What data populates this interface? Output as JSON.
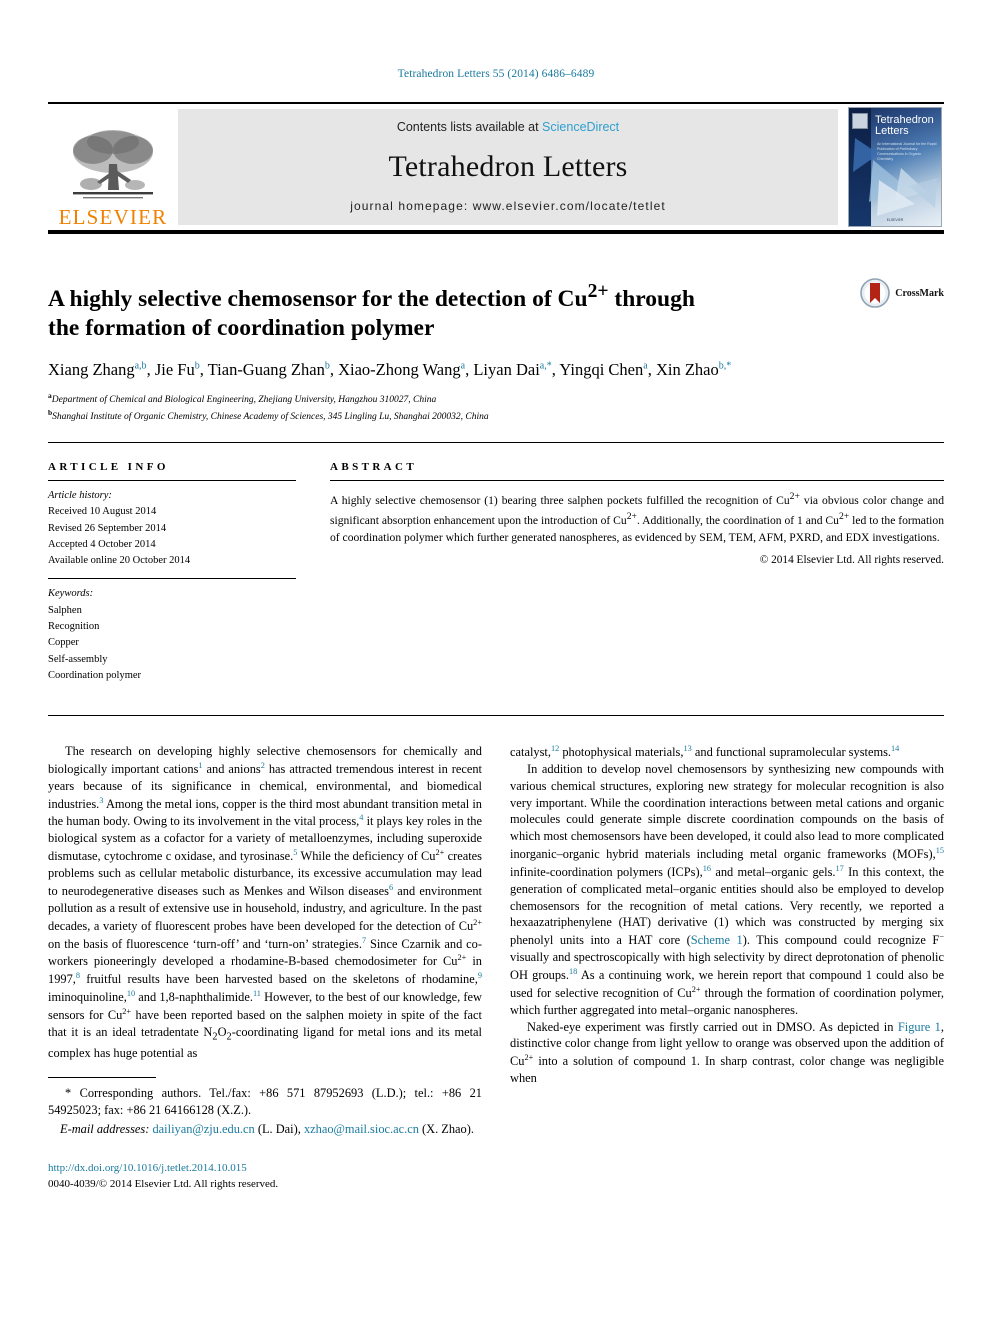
{
  "running_head": "Tetrahedron Letters 55 (2014) 6486–6489",
  "masthead": {
    "publisher_word": "ELSEVIER",
    "contents_prefix": "Contents lists available at ",
    "contents_link": "ScienceDirect",
    "journal_name": "Tetrahedron Letters",
    "homepage": "journal homepage: www.elsevier.com/locate/tetlet",
    "cover_title_line1": "Tetrahedron",
    "cover_title_line2": "Letters",
    "cover_subtitle": "An International Journal for the Rapid Publication of Preliminary Communications in Organic Chemistry",
    "cover_footer": "ELSEVIER"
  },
  "crossmark": {
    "label": "CrossMark"
  },
  "title": "A highly selective chemosensor for the detection of Cu2+ through the formation of coordination polymer",
  "title_parts": {
    "line1_a": "A highly selective chemosensor for the detection of Cu",
    "line1_sup": "2+",
    "line1_b": " through",
    "line2": "the formation of coordination polymer"
  },
  "authors": [
    {
      "name": "Xiang Zhang",
      "marks": "a,b",
      "sep": ", "
    },
    {
      "name": "Jie Fu",
      "marks": "b",
      "sep": ", "
    },
    {
      "name": "Tian-Guang Zhan",
      "marks": "b",
      "sep": ", "
    },
    {
      "name": "Xiao-Zhong Wang",
      "marks": "a",
      "sep": ", "
    },
    {
      "name": "Liyan Dai",
      "marks": "a,*",
      "sep": ", "
    },
    {
      "name": "Yingqi Chen",
      "marks": "a",
      "sep": ", "
    },
    {
      "name": "Xin Zhao",
      "marks": "b,*",
      "sep": ""
    }
  ],
  "affiliations": [
    {
      "mark": "a",
      "text": "Department of Chemical and Biological Engineering, Zhejiang University, Hangzhou 310027, China"
    },
    {
      "mark": "b",
      "text": "Shanghai Institute of Organic Chemistry, Chinese Academy of Sciences, 345 Lingling Lu, Shanghai 200032, China"
    }
  ],
  "article_info": {
    "heading": "ARTICLE INFO",
    "history_label": "Article history:",
    "history": [
      "Received 10 August 2014",
      "Revised 26 September 2014",
      "Accepted 4 October 2014",
      "Available online 20 October 2014"
    ],
    "keywords_label": "Keywords:",
    "keywords": [
      "Salphen",
      "Recognition",
      "Copper",
      "Self-assembly",
      "Coordination polymer"
    ]
  },
  "abstract": {
    "heading": "ABSTRACT",
    "p1_a": "A highly selective chemosensor (1) bearing three salphen pockets fulfilled the recognition of Cu",
    "p1_sup1": "2+",
    "p1_b": " via obvious color change and significant absorption enhancement upon the introduction of Cu",
    "p1_sup2": "2+",
    "p1_c": ". Additionally, the coordination of 1 and Cu",
    "p1_sup3": "2+",
    "p1_d": " led to the formation of coordination polymer which further generated nanospheres, as evidenced by SEM, TEM, AFM, PXRD, and EDX investigations.",
    "copyright": "© 2014 Elsevier Ltd. All rights reserved."
  },
  "body": {
    "left": {
      "p1_s1": "The research on developing highly selective chemosensors for chemically and biologically important cations",
      "r1": "1",
      "p1_s2": " and anions",
      "r2": "2",
      "p1_s3": " has attracted tremendous interest in recent years because of its significance in chemical, environmental, and biomedical industries.",
      "r3": "3",
      "p1_s4": " Among the metal ions, copper is the third most abundant transition metal in the human body. Owing to its involvement in the vital process,",
      "r4": "4",
      "p1_s5": " it plays key roles in the biological system as a cofactor for a variety of metalloenzymes, including superoxide dismutase, cytochrome c oxidase, and tyrosinase.",
      "r5": "5",
      "p1_s6": " While the deficiency of Cu",
      "sup_cu1": "2+",
      "p1_s7": " creates problems such as cellular metabolic disturbance, its excessive accumulation may lead to neurodegenerative diseases such as Menkes and Wilson diseases",
      "r6": "6",
      "p1_s8": " and environment pollution as a result of extensive use in household, industry, and agriculture. In the past decades, a variety of fluorescent probes have been developed for the detection of Cu",
      "sup_cu2": "2+",
      "p1_s9": " on the basis of fluorescence ‘turn-off’ and ‘turn-on’ strategies.",
      "r7": "7",
      "p1_s10": " Since Czarnik and co-workers pioneeringly developed a rhodamine-B-based chemodosimeter for Cu",
      "sup_cu3": "2+",
      "p1_s11": " in 1997,",
      "r8": "8",
      "p1_s12": " fruitful results have been harvested based on the skeletons of rhodamine,",
      "r9": "9",
      "p1_s13": " iminoquinoline,",
      "r10": "10",
      "p1_s14": " and 1,8-naphthalimide.",
      "r11": "11",
      "p1_s15": " However, to the best of our knowledge, few sensors for Cu",
      "sup_cu4": "2+",
      "p1_s16": " have been reported based on the salphen moiety in spite of the fact that it is an ideal tetradentate N",
      "sub_n": "2",
      "p1_s17": "O",
      "sub_o": "2",
      "p1_s18": "-coordinating ligand for metal ions and its metal complex has huge potential as"
    },
    "right": {
      "p1_s1": "catalyst,",
      "r12": "12",
      "p1_s2": " photophysical materials,",
      "r13": "13",
      "p1_s3": " and functional supramolecular systems.",
      "r14": "14",
      "p2_s1": "In addition to develop novel chemosensors by synthesizing new compounds with various chemical structures, exploring new strategy for molecular recognition is also very important. While the coordination interactions between metal cations and organic molecules could generate simple discrete coordination compounds on the basis of which most chemosensors have been developed, it could also lead to more complicated inorganic–organic hybrid materials including metal organic frameworks (MOFs),",
      "r15": "15",
      "p2_s2": " infinite-coordination polymers (ICPs),",
      "r16": "16",
      "p2_s3": " and metal–organic gels.",
      "r17": "17",
      "p2_s4": " In this context, the generation of complicated metal–organic entities should also be employed to develop chemosensors for the recognition of metal cations. Very recently, we reported a hexaazatriphenylene (HAT) derivative (1) which was constructed by merging six phenolyl units into a HAT core (",
      "scheme_link": "Scheme 1",
      "p2_s5": "). This compound could recognize F",
      "sup_f": "−",
      "p2_s6": " visually and spectroscopically with high selectivity by direct deprotonation of phenolic OH groups.",
      "r18": "18",
      "p2_s7": " As a continuing work, we herein report that compound 1 could also be used for selective recognition of Cu",
      "sup_cu5": "2+",
      "p2_s8": " through the formation of coordination polymer, which further aggregated into metal–organic nanospheres.",
      "p3_s1": "Naked-eye experiment was firstly carried out in DMSO. As depicted in ",
      "figure_link": "Figure 1",
      "p3_s2": ", distinctive color change from light yellow to orange was observed upon the addition of Cu",
      "sup_cu6": "2+",
      "p3_s3": " into a solution of compound 1. In sharp contrast, color change was negligible when"
    }
  },
  "footnotes": {
    "corresponding": "* Corresponding authors. Tel./fax: +86 571 87952693 (L.D.); tel.: +86 21 54925023; fax: +86 21 64166128 (X.Z.).",
    "email_label": "E-mail addresses:",
    "email1": "dailiyan@zju.edu.cn",
    "email1_who": " (L. Dai), ",
    "email2": "xzhao@mail.sioc.ac.cn",
    "email2_who": " (X. Zhao)."
  },
  "footer": {
    "doi": "http://dx.doi.org/10.1016/j.tetlet.2014.10.015",
    "issn": "0040-4039/© 2014 Elsevier Ltd. All rights reserved."
  },
  "colors": {
    "link": "#1a7a9e",
    "sciencedirect": "#2f9fd0",
    "elsevier_orange": "#f08000",
    "banner_gray": "#e6e6e6"
  }
}
